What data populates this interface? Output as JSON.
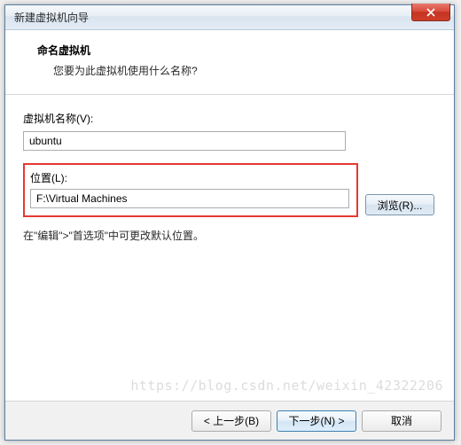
{
  "window": {
    "title": "新建虚拟机向导"
  },
  "header": {
    "title": "命名虚拟机",
    "subtitle": "您要为此虚拟机使用什么名称?"
  },
  "fields": {
    "name_label": "虚拟机名称(V):",
    "name_value": "ubuntu",
    "location_label": "位置(L):",
    "location_value": "F:\\Virtual Machines",
    "browse_label": "浏览(R)..."
  },
  "hint": "在\"编辑\">\"首选项\"中可更改默认位置。",
  "footer": {
    "back": "< 上一步(B)",
    "next": "下一步(N) >",
    "cancel": "取消"
  },
  "watermark": "https://blog.csdn.net/weixin_42322206"
}
